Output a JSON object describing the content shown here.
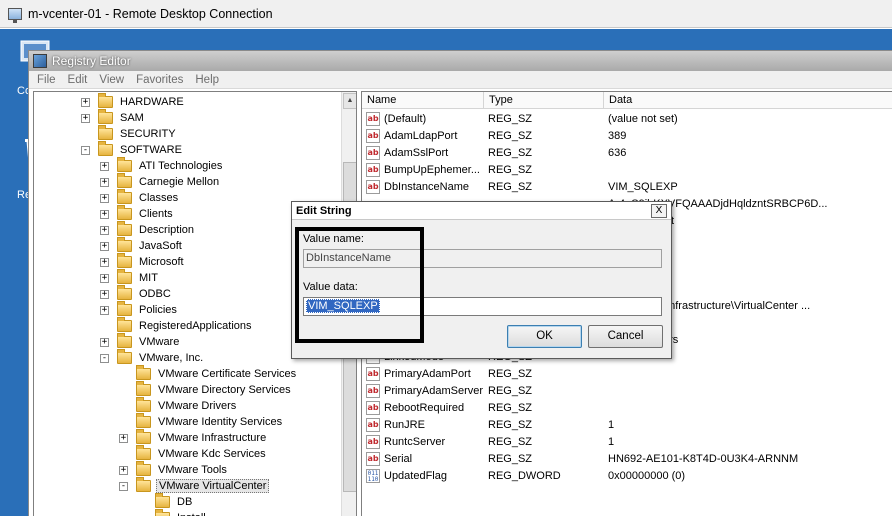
{
  "rdp": {
    "title": "m-vcenter-01 - Remote Desktop Connection",
    "desktop_labels": [
      "Co",
      "Re"
    ]
  },
  "regedit": {
    "title": "Registry Editor",
    "menu": [
      "File",
      "Edit",
      "View",
      "Favorites",
      "Help"
    ]
  },
  "tree": [
    {
      "label": "HARDWARE",
      "expander": "+"
    },
    {
      "label": "SAM",
      "expander": "+"
    },
    {
      "label": "SECURITY",
      "expander": ""
    },
    {
      "label": "SOFTWARE",
      "expander": "-"
    },
    {
      "label": "ATI Technologies",
      "expander": "+"
    },
    {
      "label": "Carnegie Mellon",
      "expander": "+"
    },
    {
      "label": "Classes",
      "expander": "+"
    },
    {
      "label": "Clients",
      "expander": "+"
    },
    {
      "label": "Description",
      "expander": "+"
    },
    {
      "label": "JavaSoft",
      "expander": "+"
    },
    {
      "label": "Microsoft",
      "expander": "+"
    },
    {
      "label": "MIT",
      "expander": "+"
    },
    {
      "label": "ODBC",
      "expander": "+"
    },
    {
      "label": "Policies",
      "expander": "+"
    },
    {
      "label": "RegisteredApplications",
      "expander": ""
    },
    {
      "label": "VMware",
      "expander": "+"
    },
    {
      "label": "VMware, Inc.",
      "expander": "-"
    },
    {
      "label": "VMware Certificate Services",
      "expander": ""
    },
    {
      "label": "VMware Directory Services",
      "expander": ""
    },
    {
      "label": "VMware Drivers",
      "expander": ""
    },
    {
      "label": "VMware Identity Services",
      "expander": ""
    },
    {
      "label": "VMware Infrastructure",
      "expander": "+"
    },
    {
      "label": "VMware Kdc Services",
      "expander": ""
    },
    {
      "label": "VMware Tools",
      "expander": "+"
    },
    {
      "label": "VMware VirtualCenter",
      "expander": "-"
    },
    {
      "label": "DB",
      "expander": ""
    },
    {
      "label": "Install",
      "expander": ""
    }
  ],
  "list": {
    "columns": [
      "Name",
      "Type",
      "Data"
    ],
    "rows": [
      {
        "name": "(Default)",
        "type": "REG_SZ",
        "data": "(value not set)",
        "icon": "ab"
      },
      {
        "name": "AdamLdapPort",
        "type": "REG_SZ",
        "data": "389",
        "icon": "ab"
      },
      {
        "name": "AdamSslPort",
        "type": "REG_SZ",
        "data": "636",
        "icon": "ab"
      },
      {
        "name": "BumpUpEphemer...",
        "type": "REG_SZ",
        "data": "",
        "icon": "ab"
      },
      {
        "name": "DbInstanceName",
        "type": "REG_SZ",
        "data": "VIM_SQLEXP",
        "icon": "ab"
      },
      {
        "name": "",
        "type": "",
        "data": "Ar4gS9ihKXVFQAAADjdHqldzntSRBCP6D...",
        "icon": ""
      },
      {
        "name": "",
        "type": "",
        "data": "kingbrook.net",
        "icon": ""
      },
      {
        "name": "",
        "type": "",
        "data": "",
        "icon": ""
      },
      {
        "name": "",
        "type": "",
        "data": "",
        "icon": ""
      },
      {
        "name": "",
        "type": "",
        "data": "",
        "icon": ""
      },
      {
        "name": "",
        "type": "",
        "data": "",
        "icon": ""
      },
      {
        "name": "",
        "type": "",
        "data": "es\\VMware\\Infrastructure\\VirtualCenter ...",
        "icon": ""
      },
      {
        "name": "",
        "type": "",
        "data": "",
        "icon": ""
      },
      {
        "name": "LDAPAdminPrincipal",
        "type": "REG_SZ",
        "data": "Administrators",
        "icon": "ab"
      },
      {
        "name": "LinkedMode",
        "type": "REG_SZ",
        "data": "",
        "icon": "ab"
      },
      {
        "name": "PrimaryAdamPort",
        "type": "REG_SZ",
        "data": "",
        "icon": "ab"
      },
      {
        "name": "PrimaryAdamServer",
        "type": "REG_SZ",
        "data": "",
        "icon": "ab"
      },
      {
        "name": "RebootRequired",
        "type": "REG_SZ",
        "data": "",
        "icon": "ab"
      },
      {
        "name": "RunJRE",
        "type": "REG_SZ",
        "data": "1",
        "icon": "ab"
      },
      {
        "name": "RuntcServer",
        "type": "REG_SZ",
        "data": "1",
        "icon": "ab"
      },
      {
        "name": "Serial",
        "type": "REG_SZ",
        "data": "HN692-AE101-K8T4D-0U3K4-ARNNM",
        "icon": "ab"
      },
      {
        "name": "UpdatedFlag",
        "type": "REG_DWORD",
        "data": "0x00000000 (0)",
        "icon": "bin"
      }
    ]
  },
  "dialog": {
    "title": "Edit String",
    "close": "X",
    "value_name_label": "Value name:",
    "value_name": "DbInstanceName",
    "value_data_label": "Value data:",
    "value_data": "VIM_SQLEXP",
    "ok": "OK",
    "cancel": "Cancel"
  },
  "colors": {
    "desktop": "#2a6fb8",
    "selection": "#3167c1",
    "reg_sz_icon": "#c0282d"
  }
}
